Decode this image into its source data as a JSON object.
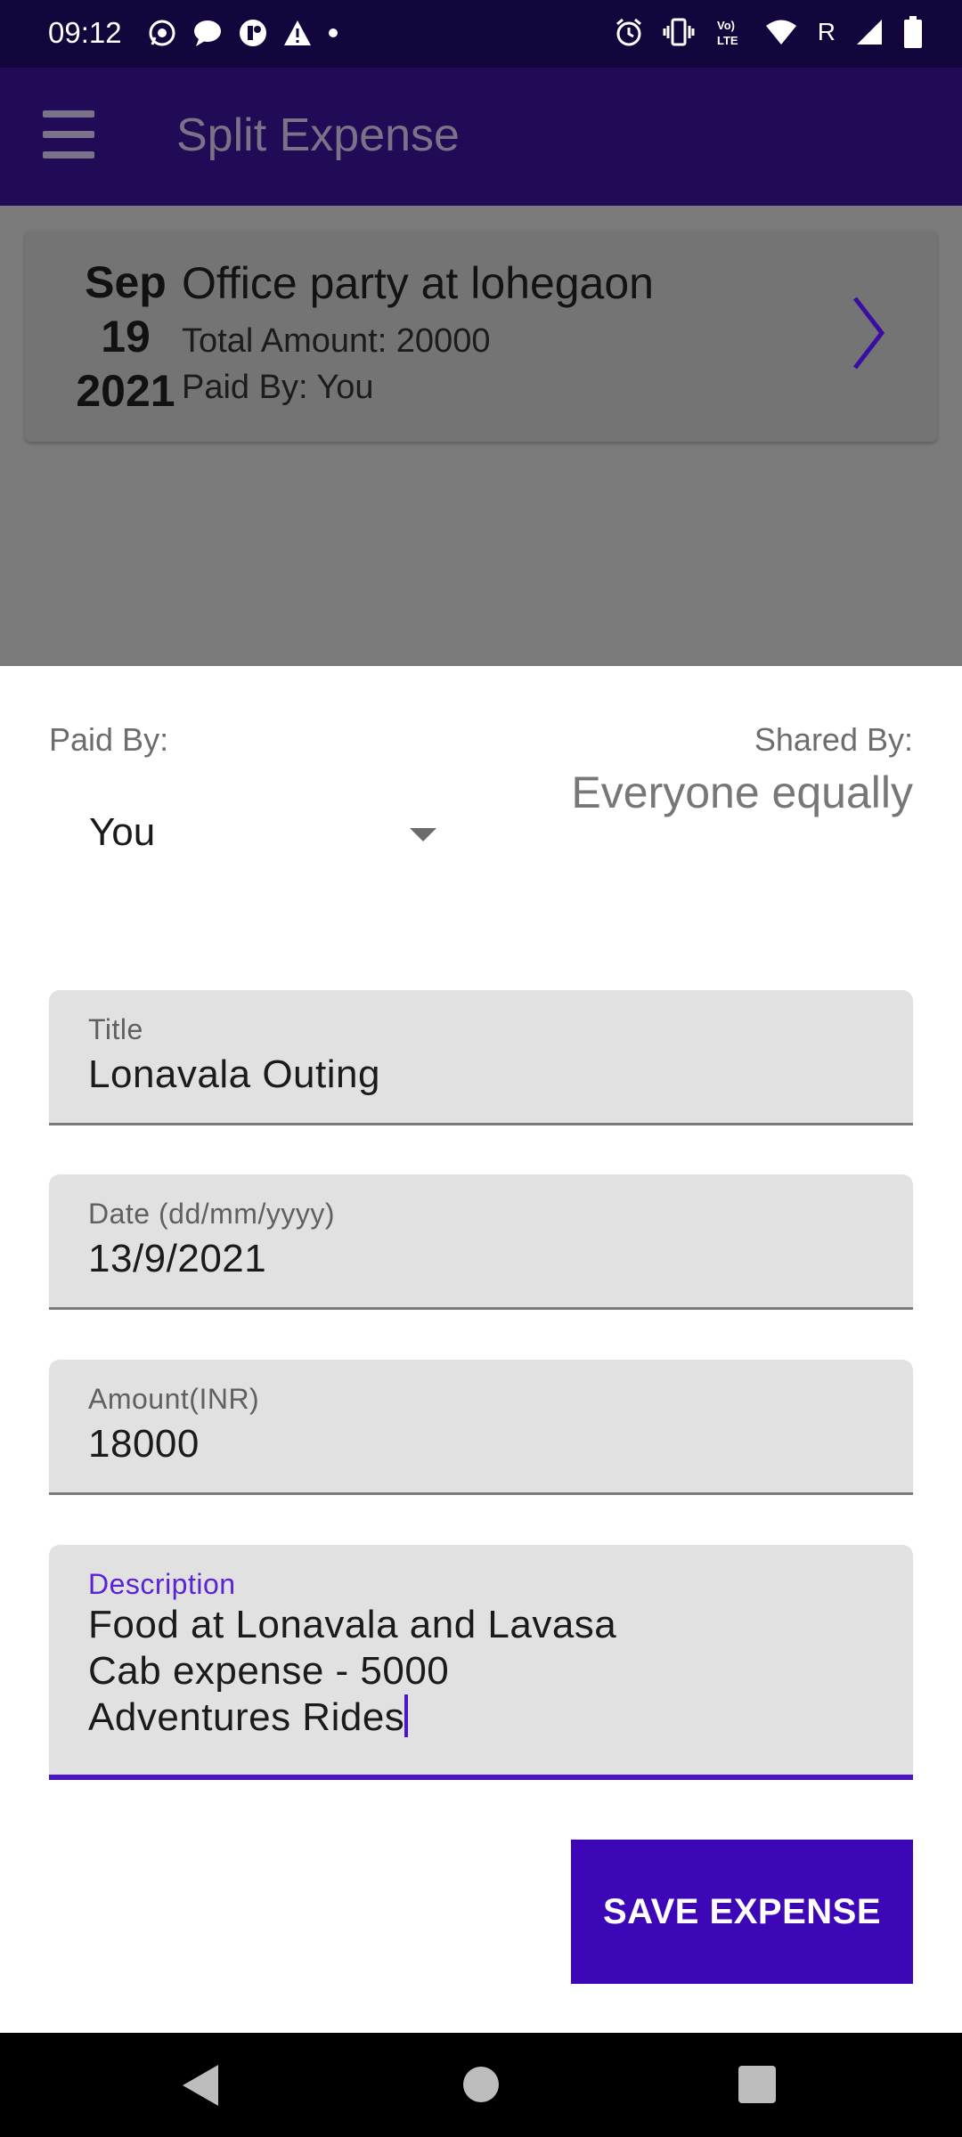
{
  "status_bar": {
    "time": "09:12",
    "left_icons": [
      "whatsapp-icon",
      "message-icon",
      "app-icon",
      "warning-icon",
      "dot-icon"
    ],
    "right_icons": [
      "alarm-icon",
      "vibrate-icon",
      "volte-icon",
      "wifi-icon",
      "signal-icon",
      "battery-icon"
    ],
    "roaming": "R",
    "volte": "LTE"
  },
  "app_bar": {
    "title": "Split Expense"
  },
  "expense_card": {
    "month": "Sep",
    "day": "19",
    "year": "2021",
    "title": "Office party at lohegaon",
    "total": "Total Amount: 20000",
    "paid_by": "Paid By: You"
  },
  "sheet": {
    "paid_by_label": "Paid By:",
    "paid_by_value": "You",
    "shared_by_label": "Shared By:",
    "shared_by_value": "Everyone equally",
    "fields": {
      "title": {
        "label": "Title",
        "value": "Lonavala Outing"
      },
      "date": {
        "label": "Date (dd/mm/yyyy)",
        "value": "13/9/2021"
      },
      "amount": {
        "label": "Amount(INR)",
        "value": "18000"
      },
      "description": {
        "label": "Description",
        "lines": [
          "Food at Lonavala and Lavasa",
          "Cab expense - 5000",
          "Adventures Rides"
        ]
      }
    },
    "save_button": "SAVE EXPENSE"
  },
  "colors": {
    "status_bar": "#12063c",
    "app_bar": "#210a56",
    "accent": "#3d06b6",
    "dim_overlay": "#7b7b7b",
    "field_bg": "#e1e1e1"
  }
}
